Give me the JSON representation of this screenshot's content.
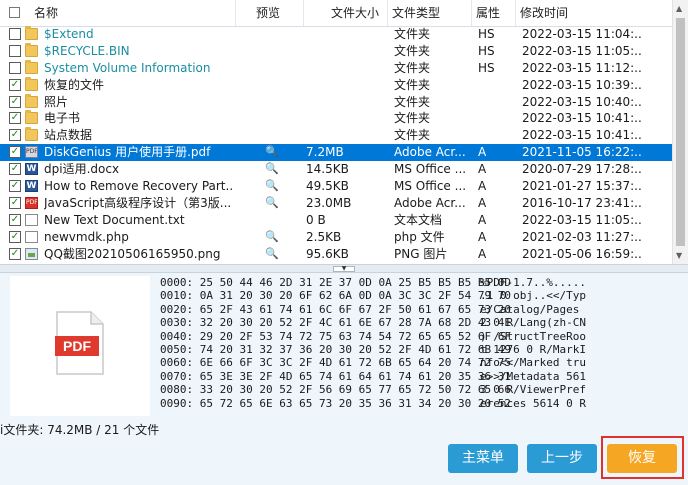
{
  "header": {
    "name": "名称",
    "preview": "预览",
    "size": "文件大小",
    "type": "文件类型",
    "attr": "属性",
    "modified": "修改时间"
  },
  "files": [
    {
      "name": "$Extend",
      "icon": "folder-icon",
      "checked": false,
      "preview": "",
      "size": "",
      "type": "文件夹",
      "attr": "HS",
      "date": "2022-03-15 11:04:...",
      "teal": true
    },
    {
      "name": "$RECYCLE.BIN",
      "icon": "folder-icon",
      "checked": false,
      "preview": "",
      "size": "",
      "type": "文件夹",
      "attr": "HS",
      "date": "2022-03-15 11:05:...",
      "teal": true
    },
    {
      "name": "System Volume Information",
      "icon": "folder-icon",
      "checked": false,
      "preview": "",
      "size": "",
      "type": "文件夹",
      "attr": "HS",
      "date": "2022-03-15 11:12:...",
      "teal": true
    },
    {
      "name": "恢复的文件",
      "icon": "folder-icon",
      "checked": true,
      "preview": "",
      "size": "",
      "type": "文件夹",
      "attr": "",
      "date": "2022-03-15 10:39:..."
    },
    {
      "name": "照片",
      "icon": "folder-icon",
      "checked": true,
      "preview": "",
      "size": "",
      "type": "文件夹",
      "attr": "",
      "date": "2022-03-15 10:40:..."
    },
    {
      "name": "电子书",
      "icon": "folder-icon",
      "checked": true,
      "preview": "",
      "size": "",
      "type": "文件夹",
      "attr": "",
      "date": "2022-03-15 10:41:..."
    },
    {
      "name": "站点数据",
      "icon": "folder-icon",
      "checked": true,
      "preview": "",
      "size": "",
      "type": "文件夹",
      "attr": "",
      "date": "2022-03-15 10:41:..."
    },
    {
      "name": "DiskGenius 用户使用手册.pdf",
      "icon": "pdf-icon",
      "checked": true,
      "preview": "🔍",
      "size": "7.2MB",
      "type": "Adobe Acr...",
      "attr": "A",
      "date": "2021-11-05 16:22:...",
      "selected": true
    },
    {
      "name": "dpi适用.docx",
      "icon": "word-icon",
      "checked": true,
      "preview": "🔍",
      "size": "14.5KB",
      "type": "MS Office ...",
      "attr": "A",
      "date": "2020-07-29 17:28:..."
    },
    {
      "name": "How to Remove Recovery Part...",
      "icon": "word-icon",
      "checked": true,
      "preview": "🔍",
      "size": "49.5KB",
      "type": "MS Office ...",
      "attr": "A",
      "date": "2021-01-27 15:37:..."
    },
    {
      "name": "JavaScript高级程序设计（第3版...",
      "icon": "pdf-red-icon",
      "checked": true,
      "preview": "🔍",
      "size": "23.0MB",
      "type": "Adobe Acr...",
      "attr": "A",
      "date": "2016-10-17 23:41:..."
    },
    {
      "name": "New Text Document.txt",
      "icon": "text-file-icon",
      "checked": true,
      "preview": "",
      "size": "0 B",
      "type": "文本文档",
      "attr": "A",
      "date": "2022-03-15 11:05:..."
    },
    {
      "name": "newvmdk.php",
      "icon": "text-file-icon",
      "checked": true,
      "preview": "🔍",
      "size": "2.5KB",
      "type": "php 文件",
      "attr": "A",
      "date": "2021-02-03 11:27:..."
    },
    {
      "name": "QQ截图20210506165950.png",
      "icon": "image-icon",
      "checked": true,
      "preview": "🔍",
      "size": "95.6KB",
      "type": "PNG 图片",
      "attr": "A",
      "date": "2021-05-06 16:59:..."
    }
  ],
  "preview": {
    "icon_label": "PDF",
    "hex_lines": [
      {
        "hex": "0000: 25 50 44 46 2D 31 2E 37 0D 0A 25 B5 B5 B5 B5 0D",
        "ascii": "%PDF-1.7..%....."
      },
      {
        "hex": "0010: 0A 31 20 30 20 6F 62 6A 0D 0A 3C 3C 2F 54 79 70",
        "ascii": ".1 0 obj..<</Typ"
      },
      {
        "hex": "0020: 65 2F 43 61 74 61 6C 6F 67 2F 50 61 67 65 73 20",
        "ascii": "e/Catalog/Pages "
      },
      {
        "hex": "0030: 32 20 30 20 52 2F 4C 61 6E 67 28 7A 68 2D 43 4E",
        "ascii": "2 0 R/Lang(zh-CN"
      },
      {
        "hex": "0040: 29 20 2F 53 74 72 75 63 74 54 72 65 65 52 6F 6F",
        "ascii": ") /StructTreeRoo"
      },
      {
        "hex": "0050: 74 20 31 32 37 36 20 30 20 52 2F 4D 61 72 6B 49",
        "ascii": "t 1276 0 R/MarkI"
      },
      {
        "hex": "0060: 6E 66 6F 3C 3C 2F 4D 61 72 6B 65 64 20 74 72 75",
        "ascii": "nfo<</Marked tru"
      },
      {
        "hex": "0070: 65 3E 3E 2F 4D 65 74 61 64 61 74 61 20 35 36 31",
        "ascii": "e>>/Metadata 561"
      },
      {
        "hex": "0080: 33 20 30 20 52 2F 56 69 65 77 65 72 50 72 65 66",
        "ascii": "3 0 R/ViewerPref"
      },
      {
        "hex": "0090: 65 72 65 6E 63 65 73 20 35 36 31 34 20 30 20 52",
        "ascii": "erences 5614 0 R"
      }
    ]
  },
  "status": {
    "text": "i文件夹: 74.2MB / 21 个文件"
  },
  "buttons": {
    "main_menu": "主菜单",
    "back": "上一步",
    "recover": "恢复"
  },
  "colors": {
    "selected_row": "#0078d7",
    "button_blue": "#2b9bd6",
    "button_orange": "#f5a623",
    "highlight_outline": "#e03030",
    "system_folder_text": "#188ea0"
  }
}
